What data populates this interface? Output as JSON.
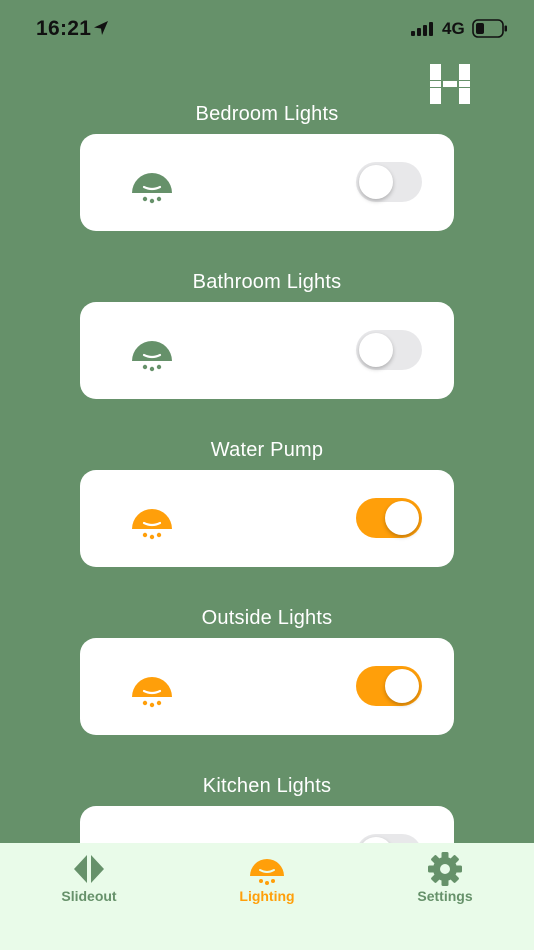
{
  "status_bar": {
    "time": "16:21",
    "network": "4G"
  },
  "icons": {
    "logo": "h-logo-icon",
    "bulb": "ceiling-light-icon",
    "slideout": "slideout-icon",
    "lighting": "ceiling-light-icon",
    "settings": "gear-icon"
  },
  "colors": {
    "background": "#66916a",
    "on_accent": "#ff9f0a",
    "off_icon": "#66916a",
    "tab_bar": "#e9fbe9",
    "tab_inactive": "#66916a"
  },
  "lights": [
    {
      "label": "Bedroom Lights",
      "on": false
    },
    {
      "label": "Bathroom Lights",
      "on": false
    },
    {
      "label": "Water Pump",
      "on": true
    },
    {
      "label": "Outside Lights",
      "on": true
    },
    {
      "label": "Kitchen Lights",
      "on": false
    }
  ],
  "tabs": [
    {
      "label": "Slideout",
      "active": false
    },
    {
      "label": "Lighting",
      "active": true
    },
    {
      "label": "Settings",
      "active": false
    }
  ]
}
